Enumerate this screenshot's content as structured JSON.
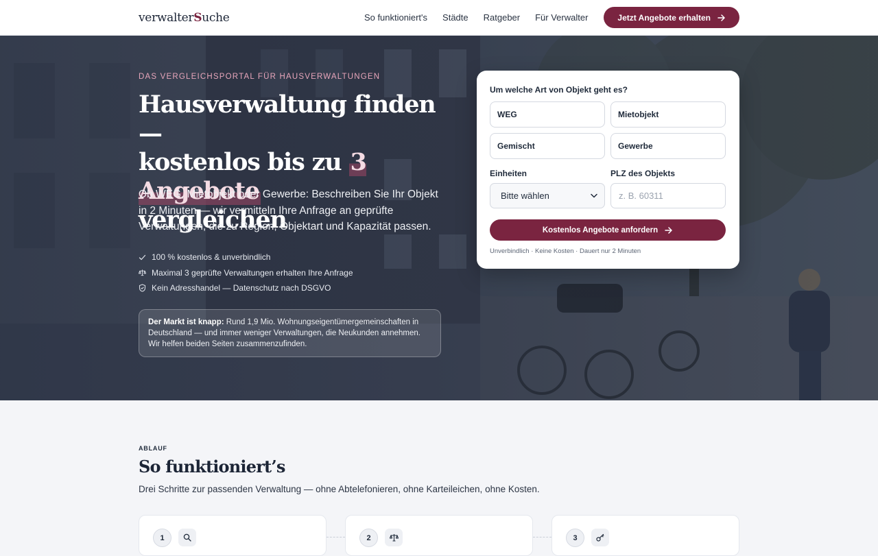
{
  "header": {
    "logo_part1": "verwalter",
    "logo_part2": "S",
    "logo_part3": "uche",
    "nav": [
      {
        "label": "So funktioniert's"
      },
      {
        "label": "Städte"
      },
      {
        "label": "Ratgeber"
      },
      {
        "label": "Für Verwalter"
      }
    ],
    "cta_label": "Jetzt Angebote erhalten"
  },
  "hero": {
    "eyebrow": "DAS VERGLEICHSPORTAL FÜR HAUSVERWALTUNGEN",
    "title_line1": "Hausverwaltung finden —",
    "title_line2_pre": "kostenlos bis zu",
    "title_highlight": "3 Angebote",
    "title_line3": "vergleichen",
    "lead": "Ob WEG, Mietobjekt oder Gewerbe: Beschreiben Sie Ihr Objekt in 2 Minuten — wir vermitteln Ihre Anfrage an geprüfte Verwaltungen, die zu Region, Objektart und Kapazität passen.",
    "checks": [
      {
        "icon": "check-icon",
        "text": "100 % kostenlos & unverbindlich"
      },
      {
        "icon": "scale-icon",
        "text": "Maximal 3 geprüfte Verwaltungen erhalten Ihre Anfrage"
      },
      {
        "icon": "shield-icon",
        "text": "Kein Adresshandel — Datenschutz nach DSGVO"
      }
    ],
    "market_bold": "Der Markt ist knapp:",
    "market_text": " Rund 1,9 Mio. Wohnungseigentümergemeinschaften in Deutschland — und immer weniger Verwaltungen, die Neukunden annehmen. Wir helfen beiden Seiten zusammenzufinden."
  },
  "form": {
    "question": "Um welche Art von Objekt geht es?",
    "options": [
      {
        "label": "WEG"
      },
      {
        "label": "Mietobjekt"
      },
      {
        "label": "Gemischt"
      },
      {
        "label": "Gewerbe"
      }
    ],
    "units_label": "Einheiten",
    "units_value": "Bitte wählen",
    "plz_label": "PLZ des Objekts",
    "plz_placeholder": "z. B. 60311",
    "submit_label": "Kostenlos Angebote anfordern",
    "fine_print": "Unverbindlich · Keine Kosten · Dauert nur 2 Minuten"
  },
  "process": {
    "eyebrow": "ABLAUF",
    "title": "So funktioniert’s",
    "lead": "Drei Schritte zur passenden Verwaltung — ohne Abtelefonieren, ohne Karteileichen, ohne Kosten.",
    "steps": [
      {
        "number": "1",
        "icon": "search-icon"
      },
      {
        "number": "2",
        "icon": "scale-icon"
      },
      {
        "number": "3",
        "icon": "key-icon"
      }
    ]
  },
  "colors": {
    "brand": "#7a2440",
    "hero_overlay": "#262e40",
    "eyebrow_pink": "#e8a6bb",
    "page_bg": "#f4f5f8"
  }
}
